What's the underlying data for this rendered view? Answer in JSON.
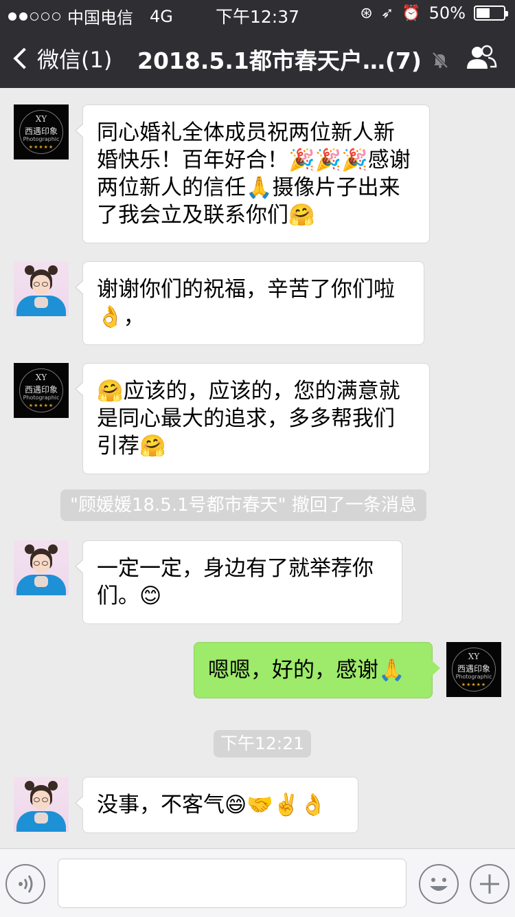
{
  "status_bar": {
    "carrier": "中国电信",
    "network": "4G",
    "time": "下午12:37",
    "battery_percent": "50%",
    "battery_level": 0.5,
    "signal_bars_filled": 2,
    "signal_bars_total": 5
  },
  "nav": {
    "back_label": "微信(1)",
    "title": "2018.5.1都市春天户…(7)",
    "icons": [
      "chevron-left-icon",
      "mute-bell-icon",
      "group-members-icon"
    ]
  },
  "messages": [
    {
      "side": "left",
      "sender_avatar": "xy-studio-logo",
      "text": "同心婚礼全体成员祝两位新人新婚快乐！百年好合！🎉🎉🎉感谢两位新人的信任🙏摄像片子出来了我会立及联系你们🤗"
    },
    {
      "side": "left",
      "sender_avatar": "girl-photo",
      "text": "谢谢你们的祝福，辛苦了你们啦👌，"
    },
    {
      "side": "left",
      "sender_avatar": "xy-studio-logo",
      "text": "🤗应该的，应该的，您的满意就是同心最大的追求，多多帮我们引荐🤗"
    },
    {
      "system": "\"顾媛媛18.5.1号都市春天\" 撤回了一条消息"
    },
    {
      "side": "left",
      "sender_avatar": "girl-photo",
      "text": "一定一定，身边有了就举荐你们。😊"
    },
    {
      "side": "right",
      "sender_avatar": "xy-studio-logo",
      "text": "嗯嗯，好的，感谢🙏"
    },
    {
      "timestamp": "下午12:21"
    },
    {
      "side": "left",
      "sender_avatar": "girl-photo",
      "text": "没事，不客气😄🤝✌️👌"
    }
  ],
  "avatar_logo": {
    "line1": "XY",
    "line2": "西遇印象",
    "line3": "Photographic",
    "stars": "★★★★★"
  },
  "input_bar": {
    "icons": [
      "voice-icon",
      "emoji-icon",
      "plus-icon"
    ]
  },
  "colors": {
    "nav_bg": "#2e2e33",
    "chat_bg": "#ebebeb",
    "my_bubble": "#9eea6a",
    "other_bubble": "#ffffff"
  }
}
